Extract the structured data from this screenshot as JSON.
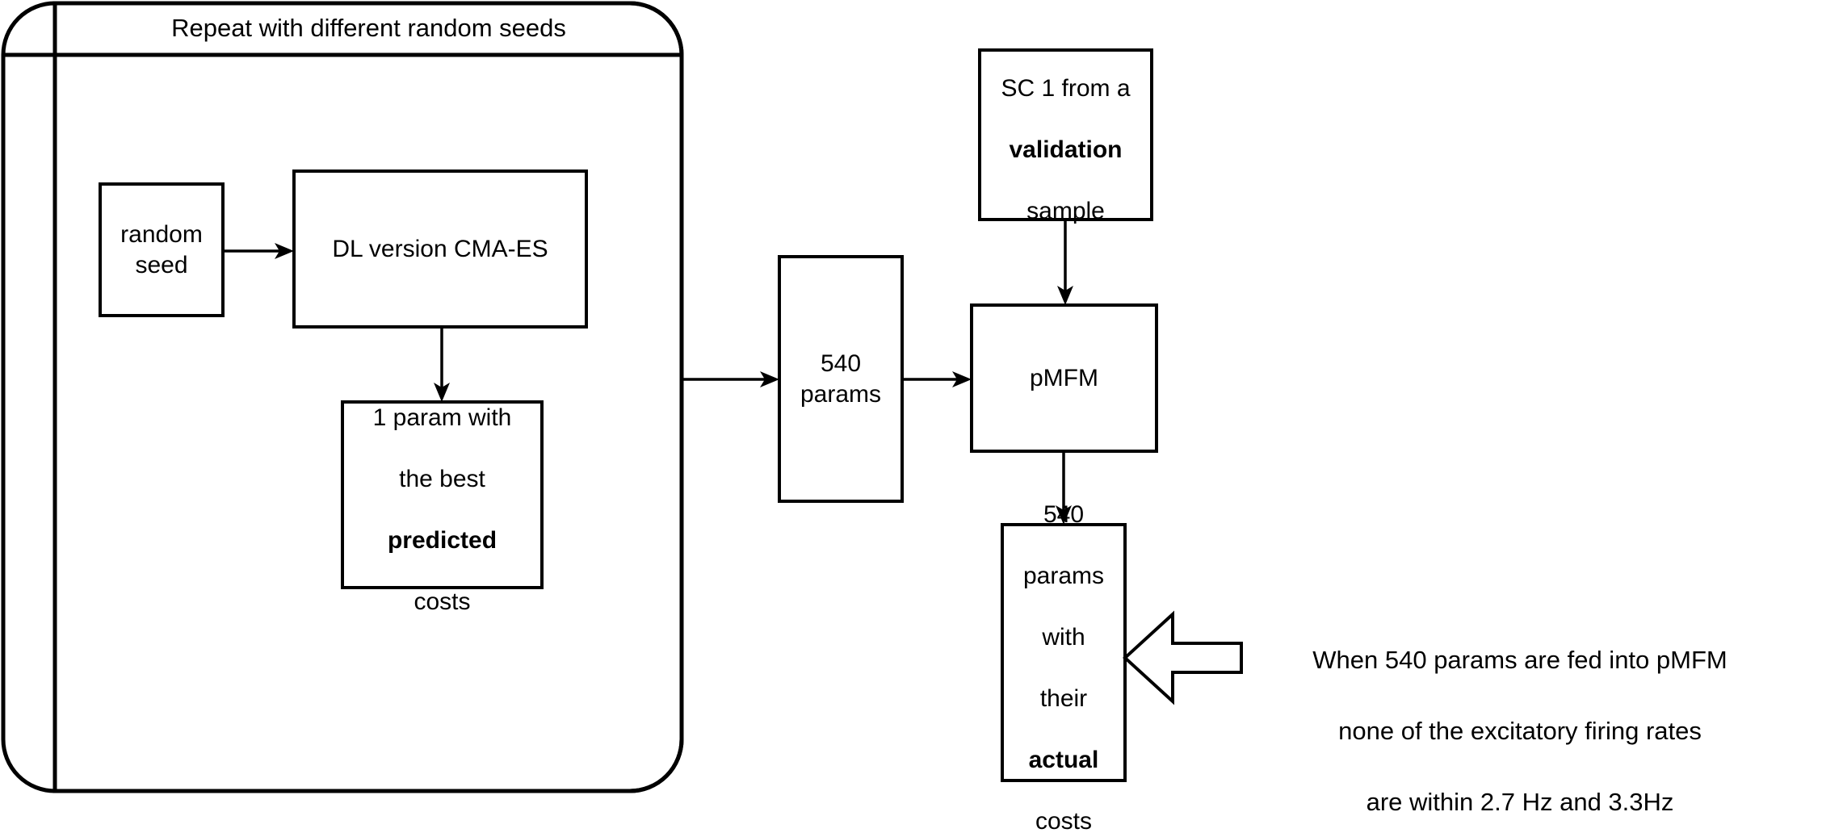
{
  "diagram": {
    "title": "Repeat with different random seeds",
    "boxes": {
      "random_seed": "random\nseed",
      "cmaes": "DL version CMA-ES",
      "best_predicted": {
        "line1": "1 param with",
        "line2": "the best",
        "line3_bold": "predicted",
        "line4": "costs"
      },
      "params_540": "540\nparams",
      "sc1_validation": {
        "line1": "SC 1 from a",
        "line2_bold": "validation",
        "line3": "sample"
      },
      "pmfm": "pMFM",
      "params_540_actual": {
        "line1": "540",
        "line2": "params",
        "line3": "with",
        "line4": "their",
        "line5_bold": "actual",
        "line6": "costs"
      }
    },
    "annotation": {
      "line1": "When 540 params are fed into pMFM",
      "line2": "none of the excitatory firing rates",
      "line3": "are within 2.7 Hz and 3.3Hz"
    },
    "colors": {
      "stroke": "#000000",
      "fill": "#ffffff",
      "background": "#ffffff"
    }
  }
}
